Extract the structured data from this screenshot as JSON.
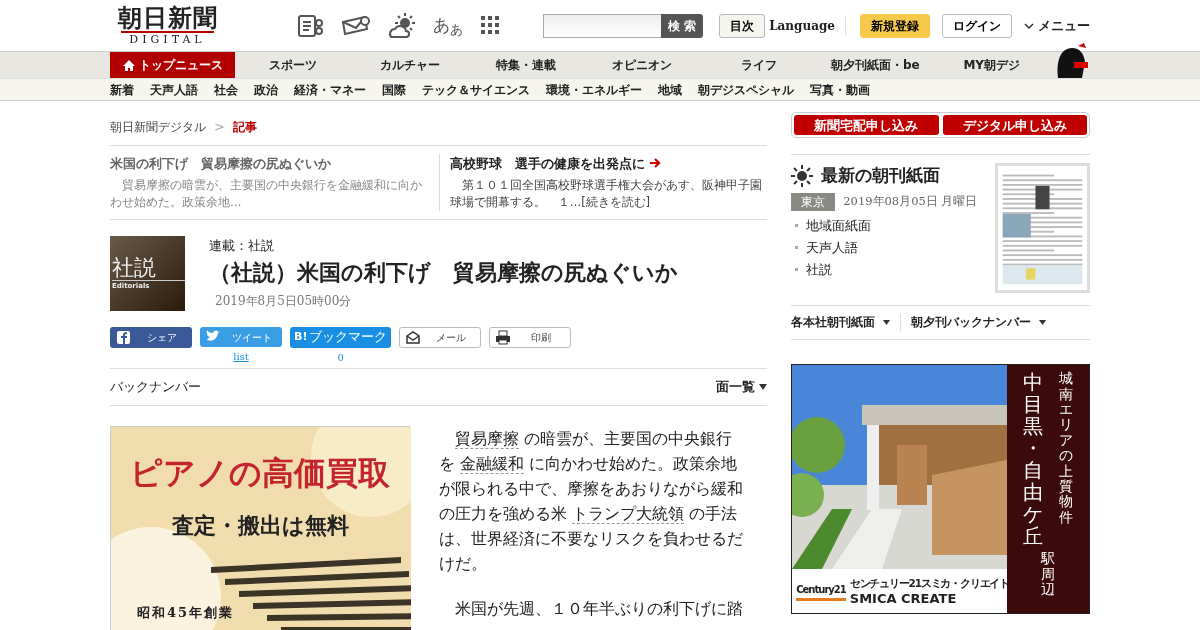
{
  "header": {
    "logo_title": "朝日新聞",
    "logo_subtitle": "DIGITAL",
    "font_size_label": "あ$_{あ}$",
    "search_button": "検 索",
    "contents_button": "目次",
    "language": "Language",
    "register": "新規登録",
    "login": "ログイン",
    "menu": "メニュー"
  },
  "main_nav": [
    {
      "label": "トップニュース",
      "selected": true
    },
    {
      "label": "スポーツ",
      "selected": false
    },
    {
      "label": "カルチャー",
      "selected": false
    },
    {
      "label": "特集・連載",
      "selected": false
    },
    {
      "label": "オピニオン",
      "selected": false
    },
    {
      "label": "ライフ",
      "selected": false
    },
    {
      "label": "朝夕刊紙面・be",
      "selected": false
    },
    {
      "label": "MY朝デジ",
      "selected": false
    }
  ],
  "sub_nav": [
    "新着",
    "天声人語",
    "社会",
    "政治",
    "経済・マネー",
    "国際",
    "テック＆サイエンス",
    "環境・エネルギー",
    "地域",
    "朝デジスペシャル",
    "写真・動画"
  ],
  "breadcrumb": [
    {
      "label": "朝日新聞デジタル",
      "current": false
    },
    {
      "label": "記事",
      "current": true
    }
  ],
  "breadcrumb_separator": ">",
  "related": [
    {
      "title": "米国の利下げ　貿易摩擦の尻ぬぐいか",
      "summary": "　貿易摩擦の暗雲が、主要国の中央銀行を金融緩和に向かわせ始めた。政策余地…",
      "current": true,
      "arrow": false
    },
    {
      "title": "高校野球　選手の健康を出発点に",
      "summary": "　第１０１回全国高校野球選手権大会があす、阪神甲子園球場で開幕する。　１…[続きを読む]",
      "current": false,
      "arrow": true
    }
  ],
  "article": {
    "logo_text": "社説",
    "logo_sub": "Editorials",
    "series": "連載：社説",
    "title": "（社説）米国の利下げ　貿易摩擦の尻ぬぐいか",
    "date": "2019年8月5日05時00分"
  },
  "share": [
    {
      "kind": "facebook",
      "label": "シェア"
    },
    {
      "kind": "twitter",
      "label": "ツイート",
      "count": "list"
    },
    {
      "kind": "hatena",
      "icon_text": "B!",
      "label": "ブックマーク",
      "count": "0"
    },
    {
      "kind": "mail",
      "label": "メール"
    },
    {
      "kind": "print",
      "label": "印刷"
    }
  ],
  "backnumber": {
    "label": "バックナンバー",
    "page_list": "面一覧"
  },
  "ad_left": {
    "headline": "ピアノの高価買取",
    "subline": "査定・搬出は無料",
    "note": "昭和45年創業"
  },
  "body": [
    [
      {
        "text": "貿易摩擦",
        "term": true
      },
      {
        "text": " の暗雲が、主要国の中央銀行を "
      },
      {
        "text": "金融緩和",
        "term": true
      },
      {
        "text": " に向かわせ始めた。政策余地が限られる中で、摩擦をあおりながら緩和の圧力を強める米 "
      },
      {
        "text": "トランプ大統領",
        "term": true
      },
      {
        "text": " の手法は、世界経済に不要なリスクを負わせるだけだ。"
      }
    ],
    [
      {
        "text": "米国が先週、１０年半ぶりの利下げに踏"
      }
    ]
  ],
  "subscribe": [
    "新聞宅配申し込み",
    "デジタル申し込み"
  ],
  "paper": {
    "title": "最新の朝刊紙面",
    "region": "東京",
    "date": "2019年08月05日 月曜日",
    "links": [
      "地域面紙面",
      "天声人語",
      "社説"
    ]
  },
  "dropdowns": [
    "各本社朝刊紙面",
    "朝夕刊バックナンバー"
  ],
  "ad_right": {
    "small_vertical": "城南エリアの上質物件",
    "big_vertical": "中目黒・自由ケ丘",
    "station": "駅周辺",
    "brand": "Century21",
    "company_kana": "センチュリー21スミカ・クリエイト",
    "company": "SMICA CREATE"
  }
}
